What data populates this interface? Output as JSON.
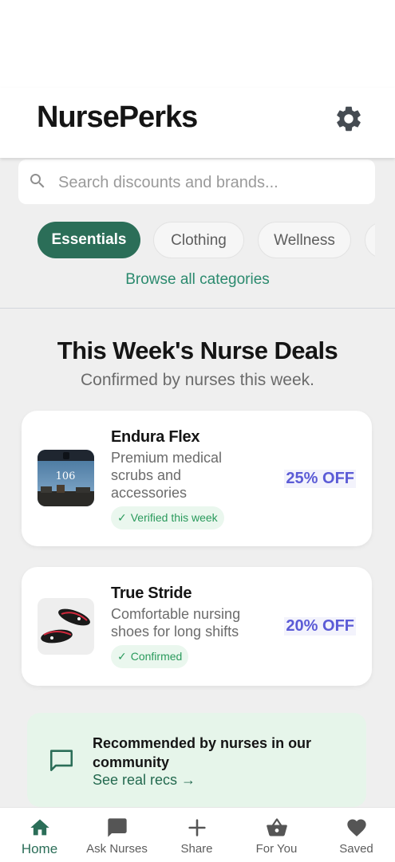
{
  "app": {
    "title": "NursePerks"
  },
  "colors": {
    "accent": "#2b6e58",
    "discount": "#5b5bd6",
    "verified": "#2a9a5c"
  },
  "header": {
    "settings_icon": "gear-icon"
  },
  "search": {
    "placeholder": "Search discounts and brands...",
    "value": "",
    "icon": "search-icon"
  },
  "categories": {
    "chips": [
      {
        "label": "Essentials",
        "selected": true
      },
      {
        "label": "Clothing",
        "selected": false
      },
      {
        "label": "Wellness",
        "selected": false
      }
    ],
    "browse_all": "Browse all categories"
  },
  "section": {
    "title": "This Week's Nurse Deals",
    "subtitle": "Confirmed by nurses this week."
  },
  "deals": [
    {
      "name": "Endura Flex",
      "description": "Premium medical scrubs and accessories",
      "badge": "Verified this week",
      "discount": "25% OFF",
      "thumb_text": "106"
    },
    {
      "name": "True Stride",
      "description": "Comfortable nursing shoes for long shifts",
      "badge": "Confirmed",
      "discount": "20% OFF"
    }
  ],
  "promo": {
    "title": "Recommended by nurses in our community",
    "link": "See real recs →",
    "icon": "chat-bubble-icon"
  },
  "nav": {
    "items": [
      {
        "label": "Home",
        "icon": "home-icon",
        "active": true
      },
      {
        "label": "Ask Nurses",
        "icon": "chat-icon",
        "active": false
      },
      {
        "label": "Share",
        "icon": "plus-icon",
        "active": false
      },
      {
        "label": "For You",
        "icon": "basket-icon",
        "active": false
      },
      {
        "label": "Saved",
        "icon": "heart-icon",
        "active": false
      }
    ]
  }
}
